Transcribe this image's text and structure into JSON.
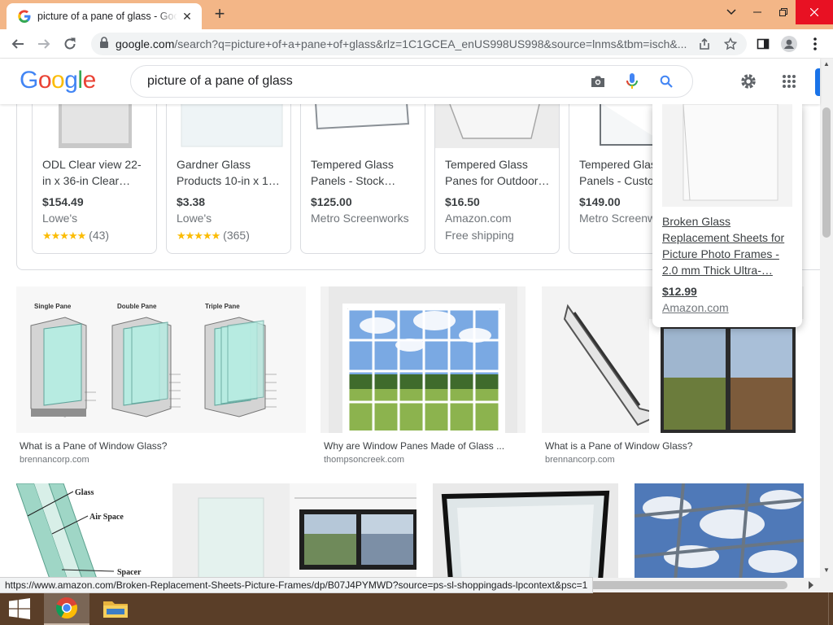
{
  "browser": {
    "tab_title": "picture of a pane of glass - Goog",
    "url_host": "google.com",
    "url_rest": "/search?q=picture+of+a+pane+of+glass&rlz=1C1GCEA_enUS998US998&source=lnms&tbm=isch&...",
    "status_url": "https://www.amazon.com/Broken-Replacement-Sheets-Picture-Frames/dp/B07J4PYMWD?source=ps-sl-shoppingads-lpcontext&psc=1"
  },
  "google": {
    "logo_letters": [
      "G",
      "o",
      "o",
      "g",
      "l",
      "e"
    ],
    "logo_colors": [
      "#4285f4",
      "#ea4335",
      "#fbbc05",
      "#4285f4",
      "#34a853",
      "#ea4335"
    ],
    "query": "picture of a pane of glass"
  },
  "products": [
    {
      "title": "ODL Clear view 22-in x 36-in Clear…",
      "price": "$154.49",
      "store": "Lowe's",
      "stars": "★★★★★",
      "rating_count": "(43)"
    },
    {
      "title": "Gardner Glass Products 10-in x 1…",
      "price": "$3.38",
      "store": "Lowe's",
      "stars": "★★★★★",
      "rating_count": "(365)"
    },
    {
      "title": "Tempered Glass Panels - Stock…",
      "price": "$125.00",
      "store": "Metro Screenworks",
      "extra": ""
    },
    {
      "title": "Tempered Glass Panes for Outdoor…",
      "price": "$16.50",
      "store": "Amazon.com",
      "extra": "Free shipping"
    },
    {
      "title": "Tempered Glass Panels - Custo…",
      "price": "$149.00",
      "store": "Metro Screenworks",
      "extra": ""
    }
  ],
  "popup": {
    "title": "Broken Glass Replacement Sheets for Picture Photo Frames - 2.0 mm Thick Ultra-…",
    "price": "$12.99",
    "store": "Amazon.com"
  },
  "results": [
    {
      "title": "What is a Pane of Window Glass?",
      "source": "brennancorp.com",
      "labels": [
        "Single Pane",
        "Double Pane",
        "Triple Pane"
      ]
    },
    {
      "title": "Why are Window Panes Made of Glass ...",
      "source": "thompsoncreek.com"
    },
    {
      "title": "What is a Pane of Window Glass?",
      "source": "brennancorp.com"
    }
  ],
  "diagram_labels": [
    "Glass",
    "Air Space",
    "Spacer"
  ],
  "colors": {
    "titlebar": "#f3b687",
    "taskbar": "#5a3e28",
    "link_blue": "#1a73e8",
    "star": "#fbbc04"
  }
}
